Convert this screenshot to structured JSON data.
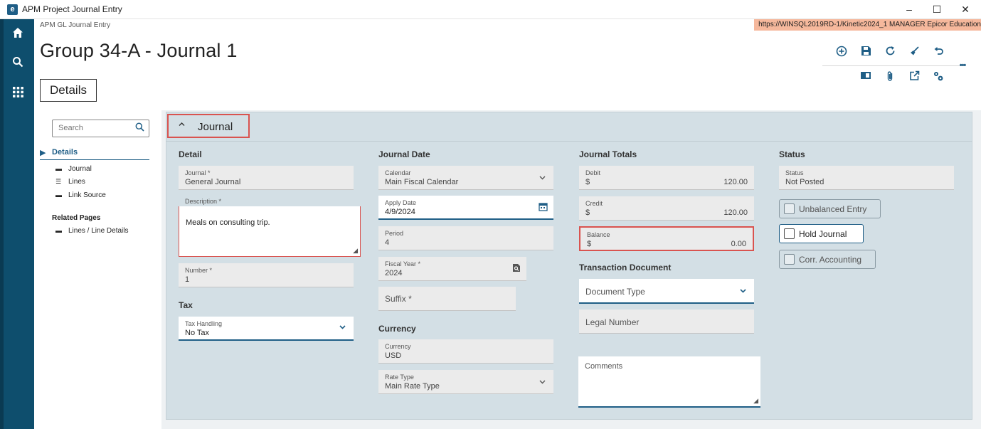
{
  "window": {
    "title": "APM Project Journal Entry",
    "minimize": "–",
    "maximize": "☐",
    "close": "✕"
  },
  "breadcrumb": "APM GL Journal Entry",
  "server_info": "https://WINSQL2019RD-1/Kinetic2024_1   MANAGER   Epicor Education",
  "page_title": "Group 34-A - Journal 1",
  "details_tab": "Details",
  "toolbar": {
    "more": "•••"
  },
  "nav": {
    "search_placeholder": "Search",
    "details_label": "Details",
    "items": [
      {
        "label": "Journal"
      },
      {
        "label": "Lines"
      },
      {
        "label": "Link Source"
      }
    ],
    "related_title": "Related Pages",
    "related_items": [
      {
        "label": "Lines / Line Details"
      }
    ]
  },
  "card": {
    "title": "Journal"
  },
  "detail": {
    "title": "Detail",
    "journal_label": "Journal *",
    "journal_value": "General Journal",
    "description_label": "Description *",
    "description_value": "Meals on consulting trip.",
    "number_label": "Number *",
    "number_value": "1"
  },
  "tax": {
    "title": "Tax",
    "handling_label": "Tax Handling",
    "handling_value": "No Tax"
  },
  "journal_date": {
    "title": "Journal Date",
    "calendar_label": "Calendar",
    "calendar_value": "Main Fiscal Calendar",
    "apply_label": "Apply Date",
    "apply_value": "4/9/2024",
    "period_label": "Period",
    "period_value": "4",
    "fiscal_year_label": "Fiscal Year *",
    "fiscal_year_value": "2024",
    "suffix_label": "Suffix *"
  },
  "currency": {
    "title": "Currency",
    "currency_label": "Currency",
    "currency_value": "USD",
    "rate_type_label": "Rate Type",
    "rate_type_value": "Main Rate Type"
  },
  "totals": {
    "title": "Journal Totals",
    "debit_label": "Debit",
    "debit_symbol": "$",
    "debit_value": "120.00",
    "credit_label": "Credit",
    "credit_symbol": "$",
    "credit_value": "120.00",
    "balance_label": "Balance",
    "balance_symbol": "$",
    "balance_value": "0.00"
  },
  "transaction_document": {
    "title": "Transaction Document",
    "doc_type_placeholder": "Document Type",
    "legal_number_placeholder": "Legal Number",
    "comments_placeholder": "Comments"
  },
  "status": {
    "title": "Status",
    "status_label": "Status",
    "status_value": "Not Posted",
    "unbalanced_label": "Unbalanced Entry",
    "hold_label": "Hold Journal",
    "corr_label": "Corr. Accounting"
  },
  "colors": {
    "rail": "#0e4e6d",
    "accent": "#1f5e86",
    "highlight_red": "#d9534f",
    "card_bg": "#d3dfe5",
    "server_badge": "#f6b89c"
  }
}
